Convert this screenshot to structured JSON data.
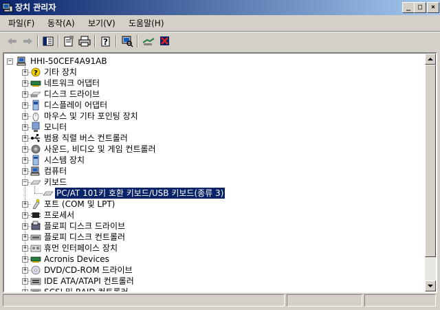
{
  "window": {
    "title": "장치 관리자"
  },
  "menu": [
    {
      "label": "파일(F)"
    },
    {
      "label": "동작(A)"
    },
    {
      "label": "보기(V)"
    },
    {
      "label": "도움말(H)"
    }
  ],
  "toolbar": [
    {
      "icon": "back-arrow-icon"
    },
    {
      "icon": "forward-arrow-icon"
    },
    {
      "icon": "show-hide-tree-icon"
    },
    {
      "icon": "properties-icon"
    },
    {
      "icon": "print-icon"
    },
    {
      "icon": "help-icon"
    },
    {
      "icon": "scan-hardware-icon"
    },
    {
      "icon": "update-driver-icon"
    },
    {
      "icon": "uninstall-icon"
    }
  ],
  "tree": {
    "root": "HHI-50CEF4A91AB",
    "items": [
      {
        "label": "기타 장치",
        "icon": "unknown-device-icon",
        "expander": "+"
      },
      {
        "label": "네트워크 어댑터",
        "icon": "network-adapter-icon",
        "expander": "+"
      },
      {
        "label": "디스크 드라이브",
        "icon": "disk-drive-icon",
        "expander": "+"
      },
      {
        "label": "디스플레이 어댑터",
        "icon": "display-adapter-icon",
        "expander": "+"
      },
      {
        "label": "마우스 및 기타 포인팅 장치",
        "icon": "mouse-icon",
        "expander": "+"
      },
      {
        "label": "모니터",
        "icon": "monitor-icon",
        "expander": "+"
      },
      {
        "label": "범용 직렬 버스 컨트롤러",
        "icon": "usb-icon",
        "expander": "+"
      },
      {
        "label": "사운드, 비디오 및 게임 컨트롤러",
        "icon": "sound-icon",
        "expander": "+"
      },
      {
        "label": "시스템 장치",
        "icon": "system-device-icon",
        "expander": "+"
      },
      {
        "label": "컴퓨터",
        "icon": "computer-icon",
        "expander": "+"
      },
      {
        "label": "키보드",
        "icon": "keyboard-icon",
        "expander": "-"
      },
      {
        "label": "PC/AT 101키 호환 키보드/USB 키보드(종류 3)",
        "icon": "keyboard-icon",
        "child": true,
        "selected": true
      },
      {
        "label": "포트 (COM 및 LPT)",
        "icon": "port-icon",
        "expander": "+"
      },
      {
        "label": "프로세서",
        "icon": "processor-icon",
        "expander": "+"
      },
      {
        "label": "플로피 디스크 드라이브",
        "icon": "floppy-drive-icon",
        "expander": "+"
      },
      {
        "label": "플로피 디스크 컨트롤러",
        "icon": "floppy-controller-icon",
        "expander": "+"
      },
      {
        "label": "휴먼 인터페이스 장치",
        "icon": "hid-icon",
        "expander": "+"
      },
      {
        "label": "Acronis Devices",
        "icon": "acronis-device-icon",
        "expander": "+"
      },
      {
        "label": "DVD/CD-ROM 드라이브",
        "icon": "cdrom-icon",
        "expander": "+"
      },
      {
        "label": "IDE ATA/ATAPI 컨트롤러",
        "icon": "ide-controller-icon",
        "expander": "+"
      },
      {
        "label": "SCSI 및 RAID 컨트롤러",
        "icon": "scsi-controller-icon",
        "expander": "+"
      }
    ]
  }
}
